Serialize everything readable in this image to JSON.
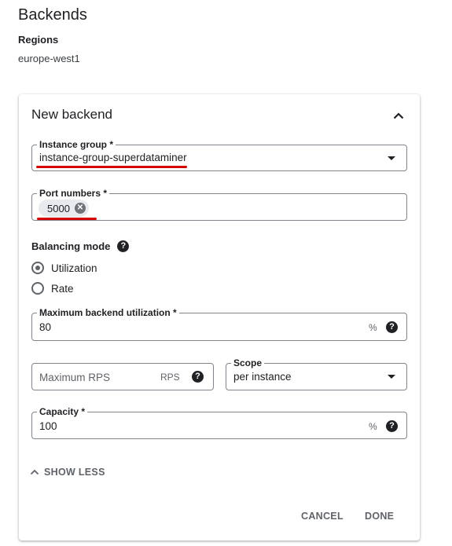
{
  "page": {
    "title": "Backends",
    "regions_label": "Regions",
    "regions_value": "europe-west1"
  },
  "card": {
    "title": "New backend",
    "instance_group": {
      "label": "Instance group *",
      "value": "instance-group-superdataminer"
    },
    "port_numbers": {
      "label": "Port numbers *",
      "chip": "5000"
    },
    "balancing_mode": {
      "label": "Balancing mode",
      "options": [
        "Utilization",
        "Rate"
      ],
      "selected": "Utilization"
    },
    "max_utilization": {
      "label": "Maximum backend utilization *",
      "value": "80",
      "suffix": "%"
    },
    "max_rps": {
      "placeholder": "Maximum RPS",
      "suffix": "RPS"
    },
    "scope": {
      "label": "Scope",
      "value": "per instance"
    },
    "capacity": {
      "label": "Capacity *",
      "value": "100",
      "suffix": "%"
    },
    "show_less": "SHOW LESS",
    "cancel": "CANCEL",
    "done": "DONE"
  },
  "colors": {
    "annotation_underline": "#d50000",
    "text": "#202124",
    "muted": "#5f6368"
  },
  "icons": [
    "chevron-up-icon",
    "dropdown-arrow-icon",
    "chip-remove-icon",
    "help-icon",
    "chevron-up-small-icon"
  ]
}
